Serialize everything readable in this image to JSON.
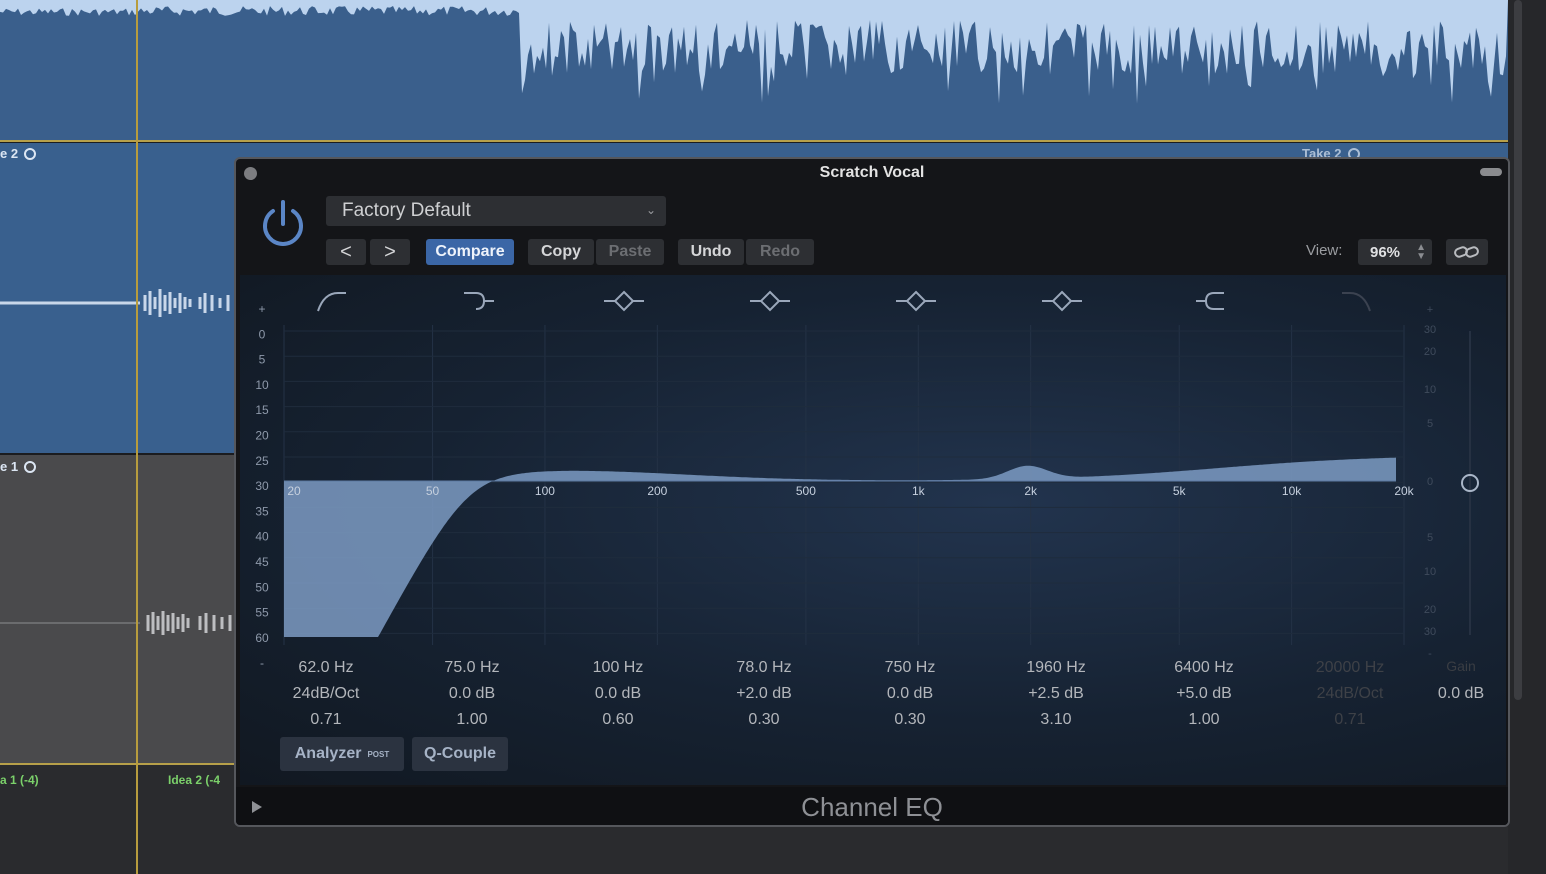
{
  "daw": {
    "take_labels": [
      "e 2",
      "e 1"
    ],
    "partial_label": "Take 2",
    "region_labels": [
      "a 1 (-4)",
      "Idea 2 (-4"
    ]
  },
  "plugin": {
    "window_title": "Scratch Vocal",
    "preset": "Factory Default",
    "buttons": {
      "prev": "<",
      "next": ">",
      "compare": "Compare",
      "copy": "Copy",
      "paste": "Paste",
      "undo": "Undo",
      "redo": "Redo"
    },
    "view_label": "View:",
    "view_value": "96%",
    "db_scale_left": [
      "+",
      "0",
      "5",
      "10",
      "15",
      "20",
      "25",
      "30",
      "35",
      "40",
      "45",
      "50",
      "55",
      "60",
      "-"
    ],
    "gain_scale_right": [
      "+",
      "30",
      "20",
      "10",
      "5",
      "0",
      "5",
      "10",
      "20",
      "30",
      "-"
    ],
    "freq_labels": [
      "20",
      "50",
      "100",
      "200",
      "500",
      "1k",
      "2k",
      "5k",
      "10k",
      "20k"
    ],
    "bands": [
      {
        "freq": "62.0 Hz",
        "gain": "24dB/Oct",
        "q": "0.71",
        "enabled": true,
        "icon": "low-cut-icon"
      },
      {
        "freq": "75.0 Hz",
        "gain": "0.0 dB",
        "q": "1.00",
        "enabled": true,
        "icon": "low-shelf-icon"
      },
      {
        "freq": "100 Hz",
        "gain": "0.0 dB",
        "q": "0.60",
        "enabled": true,
        "icon": "bell-icon"
      },
      {
        "freq": "78.0 Hz",
        "gain": "+2.0 dB",
        "q": "0.30",
        "enabled": true,
        "icon": "bell-icon"
      },
      {
        "freq": "750 Hz",
        "gain": "0.0 dB",
        "q": "0.30",
        "enabled": true,
        "icon": "bell-icon"
      },
      {
        "freq": "1960 Hz",
        "gain": "+2.5 dB",
        "q": "3.10",
        "enabled": true,
        "icon": "bell-icon"
      },
      {
        "freq": "6400 Hz",
        "gain": "+5.0 dB",
        "q": "1.00",
        "enabled": true,
        "icon": "high-shelf-icon"
      },
      {
        "freq": "20000 Hz",
        "gain": "24dB/Oct",
        "q": "0.71",
        "enabled": false,
        "icon": "high-cut-icon"
      }
    ],
    "gain_label": "Gain",
    "gain_value": "0.0 dB",
    "analyzer_label": "Analyzer",
    "analyzer_sup": "POST",
    "qcouple_label": "Q-Couple",
    "plugin_name": "Channel EQ"
  },
  "colors": {
    "accent": "#3b66a6",
    "curve_fill": "#7d9bc3",
    "track_blue": "#39608e",
    "playhead": "#b79c3e"
  }
}
